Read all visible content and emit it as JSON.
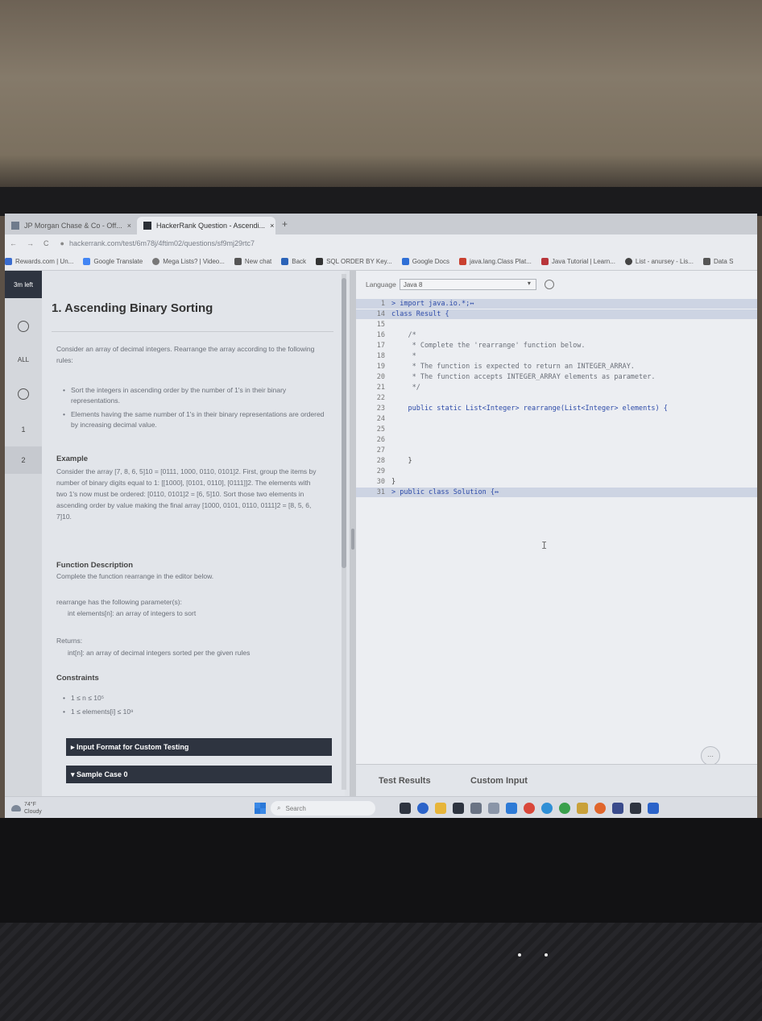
{
  "browser": {
    "tabs": [
      {
        "label": "JP Morgan Chase & Co - Off..."
      },
      {
        "label": "HackerRank Question - Ascendi..."
      }
    ],
    "new_tab": "+",
    "url": "hackerrank.com/test/6m78j/4ftim02/questions/sf9mj29rtc7",
    "bookmarks": [
      "Rewards.com | Un...",
      "Google Translate",
      "Mega Lists? | Video...",
      "New chat",
      "Back",
      "SQL ORDER BY Key...",
      "Google Docs",
      "java.lang.Class Plat...",
      "Java Tutorial | Learn...",
      "List - anursey - Lis...",
      "Data S"
    ]
  },
  "rail": {
    "time_left": "3m left",
    "all_label": "ALL",
    "questions": [
      "1",
      "2"
    ]
  },
  "problem": {
    "title": "1. Ascending Binary Sorting",
    "intro": "Consider an array of decimal integers. Rearrange the array according to the following rules:",
    "rules": [
      "Sort the integers in ascending order by the number of 1's in their binary representations.",
      "Elements having the same number of 1's in their binary representations are ordered by increasing decimal value."
    ],
    "example_label": "Example",
    "example_text": "Consider the array [7, 8, 6, 5]10 = [0111, 1000, 0110, 0101]2. First, group the items by number of binary digits equal to 1: [[1000], [0101, 0110], [0111]]2. The elements with two 1's now must be ordered: [0110, 0101]2 = [6, 5]10. Sort those two elements in ascending order by value making the final array [1000, 0101, 0110, 0111]2 = [8, 5, 6, 7]10.",
    "function_label": "Function Description",
    "function_text": "Complete the function rearrange in the editor below.",
    "params_intro": "rearrange has the following parameter(s):",
    "param": "int elements[n]: an array of integers to sort",
    "returns_label": "Returns:",
    "returns_text": "int[n]: an array of decimal integers sorted per the given rules",
    "constraints_label": "Constraints",
    "constraints": [
      "1 ≤ n ≤ 10⁵",
      "1 ≤ elements[i] ≤ 10⁹"
    ],
    "input_format_bar": "▸ Input Format for Custom Testing",
    "sample_case_bar": "▾ Sample Case 0"
  },
  "editor": {
    "language_label": "Language",
    "language_value": "Java 8",
    "lines": [
      {
        "n": "1",
        "text": "> import java.io.*;↔",
        "style": "hl"
      },
      {
        "n": "14",
        "text": "class Result {",
        "style": "hl"
      },
      {
        "n": "15",
        "text": "",
        "style": ""
      },
      {
        "n": "16",
        "text": "    /*",
        "style": "cm"
      },
      {
        "n": "17",
        "text": "     * Complete the 'rearrange' function below.",
        "style": "cm"
      },
      {
        "n": "18",
        "text": "     *",
        "style": "cm"
      },
      {
        "n": "19",
        "text": "     * The function is expected to return an INTEGER_ARRAY.",
        "style": "cm"
      },
      {
        "n": "20",
        "text": "     * The function accepts INTEGER_ARRAY elements as parameter.",
        "style": "cm"
      },
      {
        "n": "21",
        "text": "     */",
        "style": "cm"
      },
      {
        "n": "22",
        "text": "",
        "style": ""
      },
      {
        "n": "23",
        "text": "    public static List<Integer> rearrange(List<Integer> elements) {",
        "style": "code"
      },
      {
        "n": "24",
        "text": "",
        "style": ""
      },
      {
        "n": "25",
        "text": "",
        "style": ""
      },
      {
        "n": "26",
        "text": "",
        "style": ""
      },
      {
        "n": "27",
        "text": "",
        "style": ""
      },
      {
        "n": "28",
        "text": "    }",
        "style": ""
      },
      {
        "n": "29",
        "text": "",
        "style": ""
      },
      {
        "n": "30",
        "text": "}",
        "style": ""
      },
      {
        "n": "31",
        "text": "> public class Solution {↔",
        "style": "hl"
      }
    ],
    "bottom_tabs": [
      "Test Results",
      "Custom Input"
    ]
  },
  "taskbar": {
    "weather_temp": "74°F",
    "weather_desc": "Cloudy",
    "search_placeholder": "Search"
  }
}
